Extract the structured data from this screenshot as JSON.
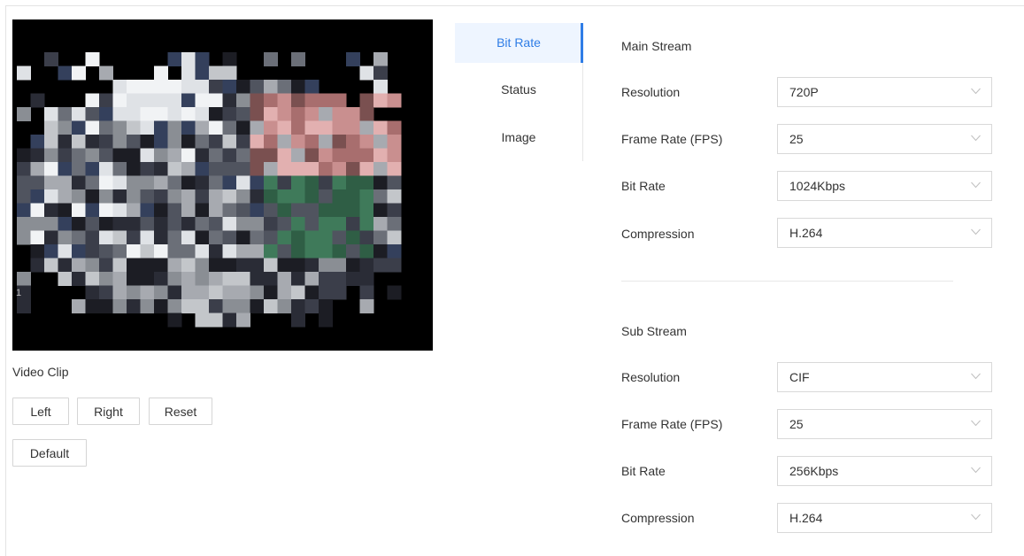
{
  "preview": {
    "channel_number": "1",
    "clip_label": "Video Clip",
    "buttons": {
      "left": "Left",
      "right": "Right",
      "reset": "Reset",
      "default": "Default"
    }
  },
  "tabs": [
    {
      "label": "Bit Rate",
      "active": true
    },
    {
      "label": "Status",
      "active": false
    },
    {
      "label": "Image",
      "active": false
    }
  ],
  "main_stream": {
    "title": "Main Stream",
    "fields": [
      {
        "label": "Resolution",
        "value": "720P"
      },
      {
        "label": "Frame Rate (FPS)",
        "value": "25"
      },
      {
        "label": "Bit Rate",
        "value": "1024Kbps"
      },
      {
        "label": "Compression",
        "value": "H.264"
      }
    ]
  },
  "sub_stream": {
    "title": "Sub Stream",
    "fields": [
      {
        "label": "Resolution",
        "value": "CIF"
      },
      {
        "label": "Frame Rate (FPS)",
        "value": "25"
      },
      {
        "label": "Bit Rate",
        "value": "256Kbps"
      },
      {
        "label": "Compression",
        "value": "H.264"
      }
    ]
  },
  "icons": {
    "dropdown": "chevron-down-icon"
  },
  "colors": {
    "accent": "#2f7de6",
    "active_tab_bg": "#eef5ff"
  }
}
